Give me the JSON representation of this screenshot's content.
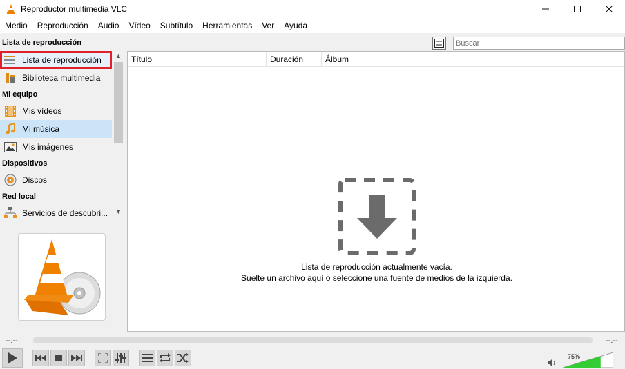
{
  "window": {
    "title": "Reproductor multimedia VLC",
    "controls": [
      "minimize-icon",
      "maximize-icon",
      "close-icon"
    ]
  },
  "menu": [
    "Medio",
    "Reproducción",
    "Audio",
    "Vídeo",
    "Subtítulo",
    "Herramientas",
    "Ver",
    "Ayuda"
  ],
  "sidebar": {
    "header": "Lista de reproducción",
    "top_items": [
      {
        "label": "Lista de reproducción",
        "icon": "playlist-icon"
      },
      {
        "label": "Biblioteca multimedia",
        "icon": "media-library-icon"
      }
    ],
    "my_computer": {
      "label": "Mi equipo",
      "items": [
        {
          "label": "Mis vídeos",
          "icon": "film-icon"
        },
        {
          "label": "Mi música",
          "icon": "music-note-icon"
        },
        {
          "label": "Mis imágenes",
          "icon": "picture-icon"
        }
      ]
    },
    "devices": {
      "label": "Dispositivos",
      "items": [
        {
          "label": "Discos",
          "icon": "disc-icon"
        }
      ]
    },
    "network": {
      "label": "Red local",
      "items": [
        {
          "label": "Servicios de descubri...",
          "icon": "network-icon"
        }
      ]
    }
  },
  "search": {
    "placeholder": "Buscar"
  },
  "playlist": {
    "columns": [
      "Título",
      "Duración",
      "Álbum"
    ],
    "empty_line1": "Lista de reproducción actualmente vacía.",
    "empty_line2": "Suelte un archivo aquí o seleccione una fuente de medios de la izquierda."
  },
  "player": {
    "time_elapsed": "--:--",
    "time_total": "--:--",
    "volume_label": "75%",
    "volume_level": 0.75,
    "colors": {
      "accent": "#f08000",
      "volume": "#33cc33",
      "highlight": "#e0202a"
    }
  }
}
